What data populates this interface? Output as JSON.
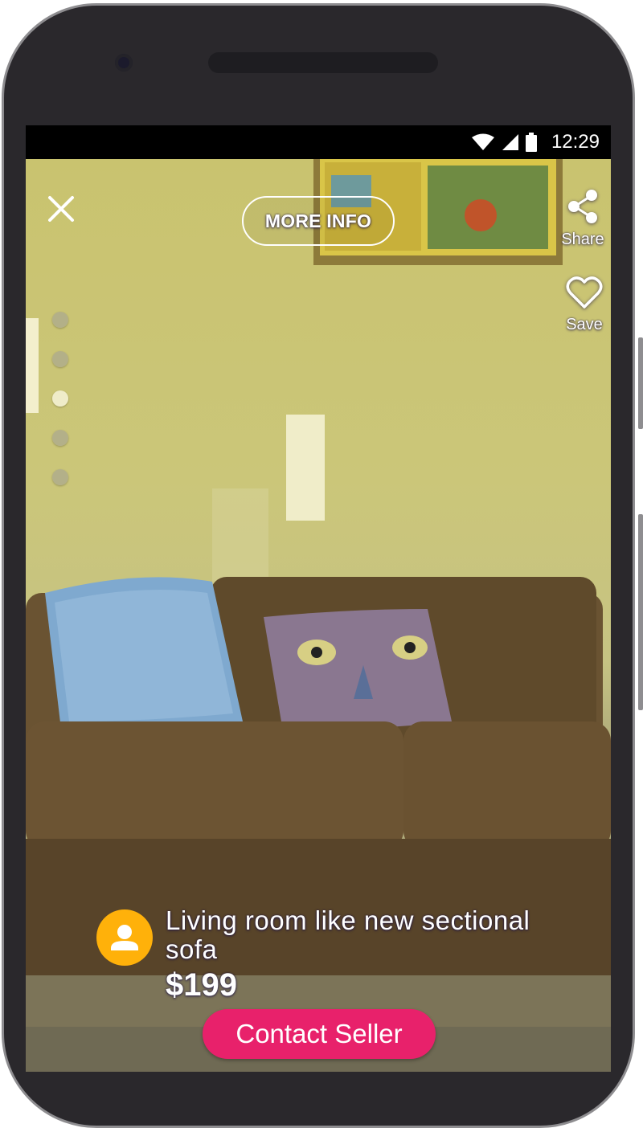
{
  "status_bar": {
    "time": "12:29",
    "icons": [
      "wifi-icon",
      "cell-signal-icon",
      "battery-icon"
    ]
  },
  "top_bar": {
    "close_icon": "close-icon",
    "more_info_label": "MORE INFO"
  },
  "actions": {
    "share_label": "Share",
    "share_icon": "share-icon",
    "save_label": "Save",
    "save_icon": "heart-outline-icon"
  },
  "gallery": {
    "image_count": 5,
    "active_index": 3
  },
  "listing": {
    "title": "Living room like new sectional sofa",
    "price": "$199",
    "avatar_icon": "person-icon"
  },
  "contact_button_label": "Contact Seller",
  "colors": {
    "accent": "#e8216b",
    "avatar": "#ffb10a"
  }
}
